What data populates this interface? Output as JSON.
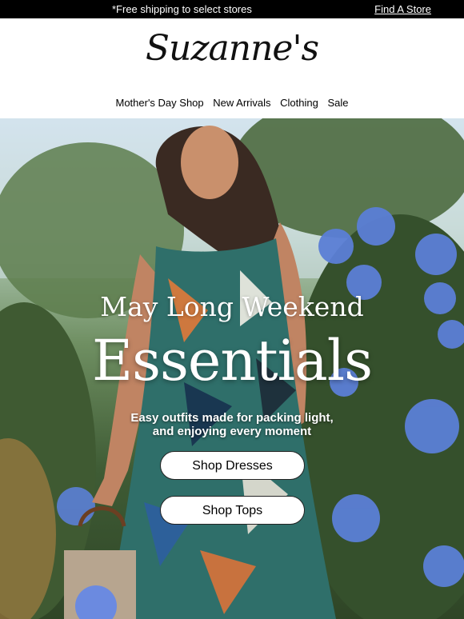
{
  "topbar": {
    "promo": "*Free shipping to select stores",
    "store_link": "Find A Store"
  },
  "brand": {
    "logo_text": "Suzanne's"
  },
  "nav": {
    "items": [
      "Mother's Day Shop",
      "New Arrivals",
      "Clothing",
      "Sale"
    ]
  },
  "hero": {
    "headline_small": "May Long Weekend",
    "headline_large": "Essentials",
    "subcopy_line1": "Easy outfits made for packing light,",
    "subcopy_line2": "and enjoying every moment",
    "cta_primary": "Shop Dresses",
    "cta_secondary": "Shop Tops"
  },
  "colors": {
    "topbar_bg": "#000000",
    "hydrangea": "#5b7fd6",
    "foliage": "#3f5c35"
  }
}
